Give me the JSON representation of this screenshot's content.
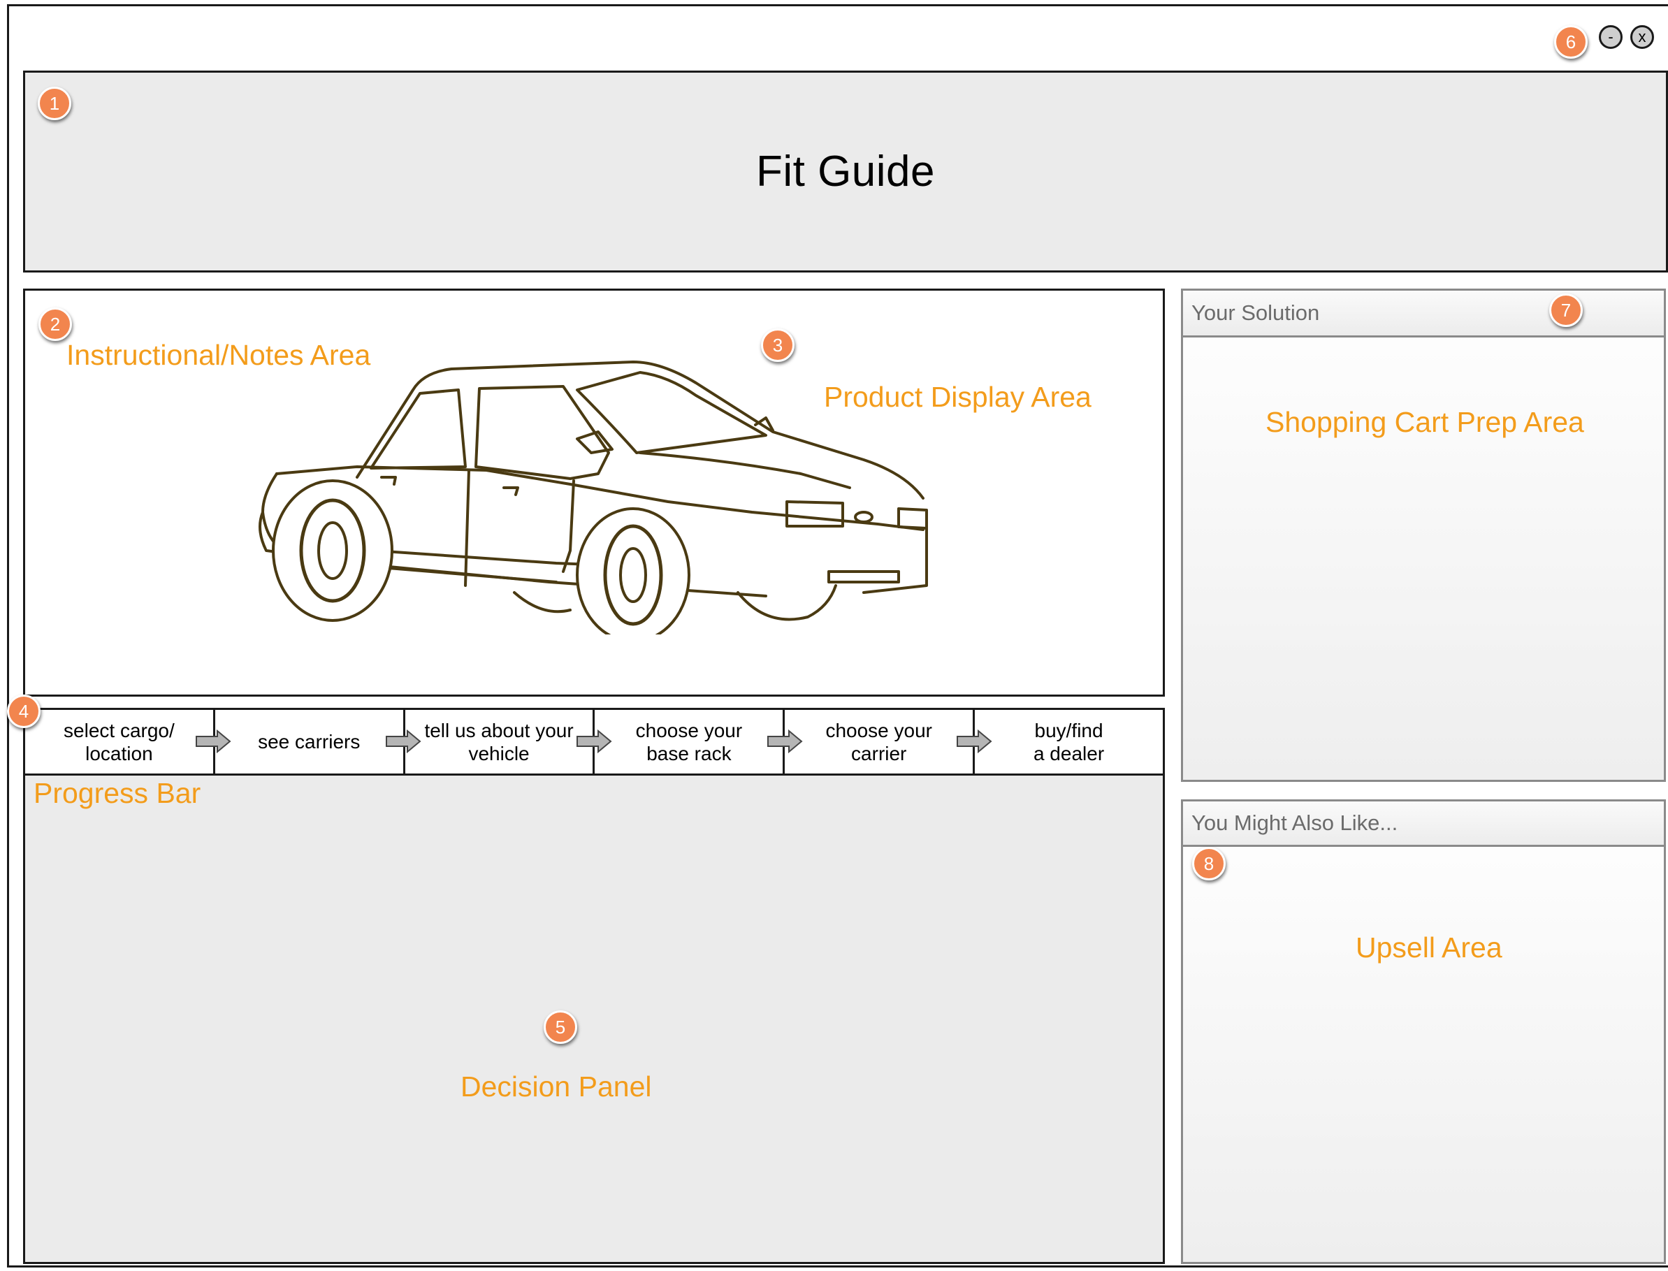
{
  "window": {
    "title": "Fit Guide",
    "minimize_label": "-",
    "close_label": "x"
  },
  "annotations": {
    "badges": [
      "1",
      "2",
      "3",
      "4",
      "5",
      "6",
      "7",
      "8"
    ],
    "instructional": "Instructional/Notes Area",
    "product_display": "Product Display Area",
    "progress_bar": "Progress Bar",
    "decision_panel": "Decision Panel",
    "shopping_cart": "Shopping Cart Prep Area",
    "upsell": "Upsell Area"
  },
  "progress": {
    "steps": [
      {
        "line1": "select cargo/",
        "line2": "location"
      },
      {
        "line1": "see carriers",
        "line2": ""
      },
      {
        "line1": "tell us about your",
        "line2": "vehicle"
      },
      {
        "line1": "choose your",
        "line2": "base rack"
      },
      {
        "line1": "choose your",
        "line2": "carrier"
      },
      {
        "line1": "buy/find",
        "line2": "a dealer"
      }
    ]
  },
  "solution_panel": {
    "title": "Your Solution"
  },
  "upsell_panel": {
    "title": "You Might Also Like..."
  },
  "colors": {
    "accent": "#f39c1b",
    "badge": "#f2854e",
    "panel_gray": "#ebebeb"
  },
  "icons": [
    "car-illustration",
    "arrow-right-icon",
    "minimize-icon",
    "close-icon"
  ]
}
